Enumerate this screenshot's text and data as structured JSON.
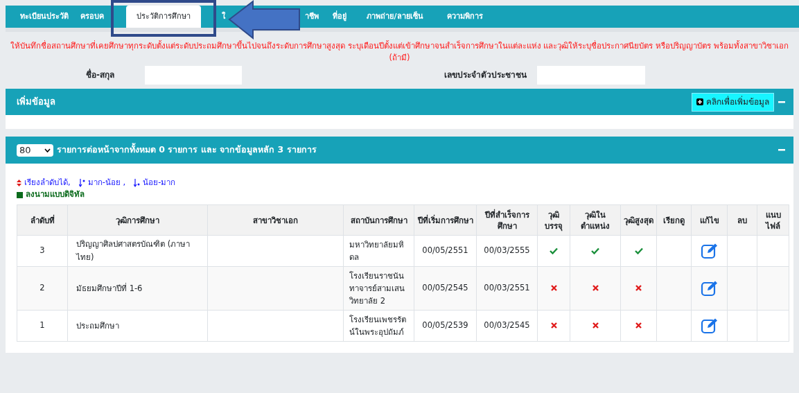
{
  "tabs": [
    {
      "label": "ทะเบียนประวัติ",
      "selected": false
    },
    {
      "label": "ครอบค",
      "selected": false
    },
    {
      "label": "ประวัติการศึกษา",
      "selected": true
    },
    {
      "label": "ใ",
      "selected": false
    },
    {
      "label": "าชีพ",
      "selected": false
    },
    {
      "label": "ที่อยู่",
      "selected": false
    },
    {
      "label": "ภาพถ่าย/ลายเซ็น",
      "selected": false
    },
    {
      "label": "ความพิการ",
      "selected": false
    }
  ],
  "notice": "ให้บันทึกชื่อสถานศึกษาที่เคยศึกษาทุกระดับตั้งแต่ระดับประถมศึกษาขึ้นไปจนถึงระดับการศึกษาสูงสุด ระบุเดือนปีตั้งแต่เข้าศึกษาจนสำเร็จการศึกษาในแต่ละแห่ง และวุฒิให้ระบุชื่อประกาศนียบัตร หรือปริญญาบัตร พร้อมทั้งสาขาวิชาเอก (ถ้ามี)",
  "name_label": "ชื่อ-สกุล",
  "id_label": "เลขประจำตัวประชาชน",
  "add_panel": {
    "title": "เพิ่มข้อมูล",
    "button": "คลิกเพื่อเพิ่มข้อมูล"
  },
  "list_panel": {
    "page_size": "80",
    "summary": "รายการต่อหน้าจากทั้งหมด 0 รายการ และ จากข้อมูลหลัก 3 รายการ",
    "sort_hint": "เรียงลำดับได้,",
    "sort_desc": "มาก-น้อย ,",
    "sort_asc": "น้อย-มาก",
    "legend": "ลงนามแบบดิจิทัล",
    "columns": [
      "ลำดับที่",
      "วุฒิการศึกษา",
      "สาขาวิชาเอก",
      "สถาบันการศึกษา",
      "ปีที่เริ่มการศึกษา",
      "ปีที่สำเร็จการศึกษา",
      "วุฒิบรรจุ",
      "วุฒิในตำแหน่ง",
      "วุฒิสูงสุด",
      "เรียกดู",
      "แก้ไข",
      "ลบ",
      "แนบไฟล์"
    ],
    "rows": [
      {
        "no": "3",
        "degree": "ปริญญาศิลปศาสตรบัณฑิต (ภาษาไทย)",
        "institution": "มหาวิทยาลัยมหิดล",
        "start": "00/05/2551",
        "end": "00/03/2555",
        "appointed": true,
        "in_position": true,
        "highest": true
      },
      {
        "no": "2",
        "degree": "มัธยมศึกษาปีที่ 1-6",
        "institution": "โรงเรียนราชนันทาจารย์สามเสนวิทยาลัย 2",
        "start": "00/05/2545",
        "end": "00/03/2551",
        "appointed": false,
        "in_position": false,
        "highest": false
      },
      {
        "no": "1",
        "degree": "ประถมศึกษา",
        "institution": "โรงเรียนเพชรรัตน์ในพระอุปถัมภ์",
        "start": "00/05/2539",
        "end": "00/03/2545",
        "appointed": false,
        "in_position": false,
        "highest": false
      }
    ]
  }
}
